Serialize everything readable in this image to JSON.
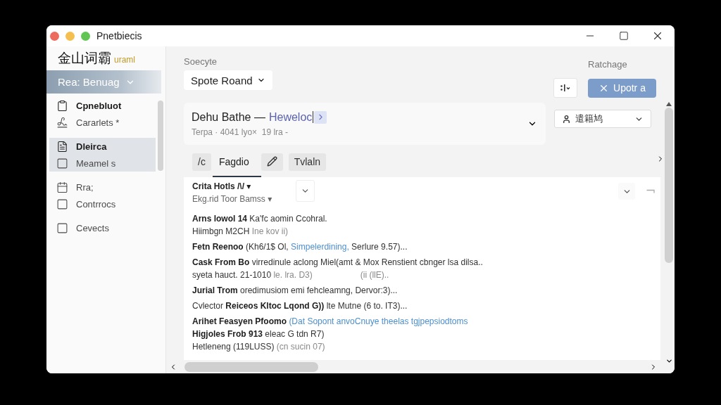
{
  "window": {
    "title": "Pnetbiecis"
  },
  "sidebar": {
    "brand": "金山词霸",
    "brand_tag": "uraml",
    "selector": "Rea: Benuag",
    "groups": [
      {
        "items": [
          {
            "label": "Cpnebluot",
            "bold": true,
            "selected": false
          },
          {
            "label": "Cararlets *",
            "bold": false,
            "selected": false
          }
        ]
      },
      {
        "items": [
          {
            "label": "Dleirca",
            "bold": true,
            "selected": true
          },
          {
            "label": "Meamel s",
            "bold": false,
            "selected": true
          }
        ]
      },
      {
        "items": [
          {
            "label": "Rra;",
            "bold": false,
            "selected": false
          },
          {
            "label": "Contrrocs",
            "bold": false,
            "selected": false
          }
        ]
      },
      {
        "items": [
          {
            "label": "Cevects",
            "bold": false,
            "selected": false
          }
        ]
      }
    ]
  },
  "toolbar": {
    "source_label": "Soecyte",
    "source_value": "Spote Roand",
    "action_label": "Ratchage",
    "primary_button": "Upotr a"
  },
  "document": {
    "title": "Dehu Bathe —",
    "link": "Heweloc",
    "meta": "Terpa · 4041 lyo×  19 lra -"
  },
  "language_select": {
    "value": "遣籍鸠"
  },
  "tabs": [
    {
      "kind": "chip",
      "label": "/c",
      "selected": false
    },
    {
      "kind": "text",
      "label": "Fagdio",
      "selected": true
    },
    {
      "kind": "pencil",
      "selected": false
    },
    {
      "kind": "chip",
      "label": "Tvlaln",
      "selected": false
    }
  ],
  "list": {
    "title": "Crita Hotls /\\/ ▾",
    "subtitle": "Ekg.rid Toor Bamss ▾",
    "entries": [
      {
        "lines": [
          {
            "segments": [
              {
                "kind": "bold",
                "text": "Arns lowol 14"
              },
              {
                "kind": "plain",
                "text": " Ka'fc aomin Ccohral."
              }
            ]
          },
          {
            "segments": [
              {
                "kind": "plain",
                "text": "Hiimbgn M2CH"
              },
              {
                "kind": "muted",
                "text": " Ine kov ii)"
              }
            ]
          }
        ]
      },
      {
        "lines": [
          {
            "segments": [
              {
                "kind": "bold",
                "text": "Fetn Reenoo"
              },
              {
                "kind": "plain",
                "text": " (Kh6/1$ Ol, "
              },
              {
                "kind": "link",
                "text": "Simpelerdining,"
              },
              {
                "kind": "plain",
                "text": " Serlure 9.57)..."
              }
            ]
          }
        ]
      },
      {
        "lines": [
          {
            "segments": [
              {
                "kind": "bold",
                "text": "Cask From Bo"
              },
              {
                "kind": "plain",
                "text": " virredinule aclong Miel(amt & Mox Renstient cbnger lsa dilsa.."
              }
            ]
          },
          {
            "segments": [
              {
                "kind": "plain",
                "text": "syeta hauct. 21-1010"
              },
              {
                "kind": "muted",
                "text": " le. lra. D3)"
              }
            ],
            "aside": "(ii (llE).."
          }
        ]
      },
      {
        "lines": [
          {
            "segments": [
              {
                "kind": "bold",
                "text": "Jurial Trom"
              },
              {
                "kind": "plain",
                "text": " oredimusiom emi fehcleamng, Dervor:3)..."
              }
            ]
          }
        ]
      },
      {
        "lines": [
          {
            "segments": [
              {
                "kind": "plain",
                "text": "Cvlector "
              },
              {
                "kind": "bold",
                "text": "Reiceos Kltoc Lqond G))"
              },
              {
                "kind": "plain",
                "text": " lte Mutne (6 to. IT3)..."
              }
            ]
          }
        ]
      },
      {
        "lines": [
          {
            "segments": [
              {
                "kind": "bold",
                "text": "Arihet Feasyen Pfoomo "
              },
              {
                "kind": "link",
                "text": "(Dat Sopont anvoCnuye theelas tgjpepsiodtoms"
              }
            ]
          },
          {
            "segments": [
              {
                "kind": "bold",
                "text": "Higjoles Frob 913"
              },
              {
                "kind": "plain",
                "text": " eleac G tdn R7)"
              }
            ]
          },
          {
            "segments": [
              {
                "kind": "plain",
                "text": "Hetleneng (119LUSS)"
              },
              {
                "kind": "muted",
                "text": " (cn sucin 07)"
              }
            ]
          }
        ]
      }
    ]
  }
}
